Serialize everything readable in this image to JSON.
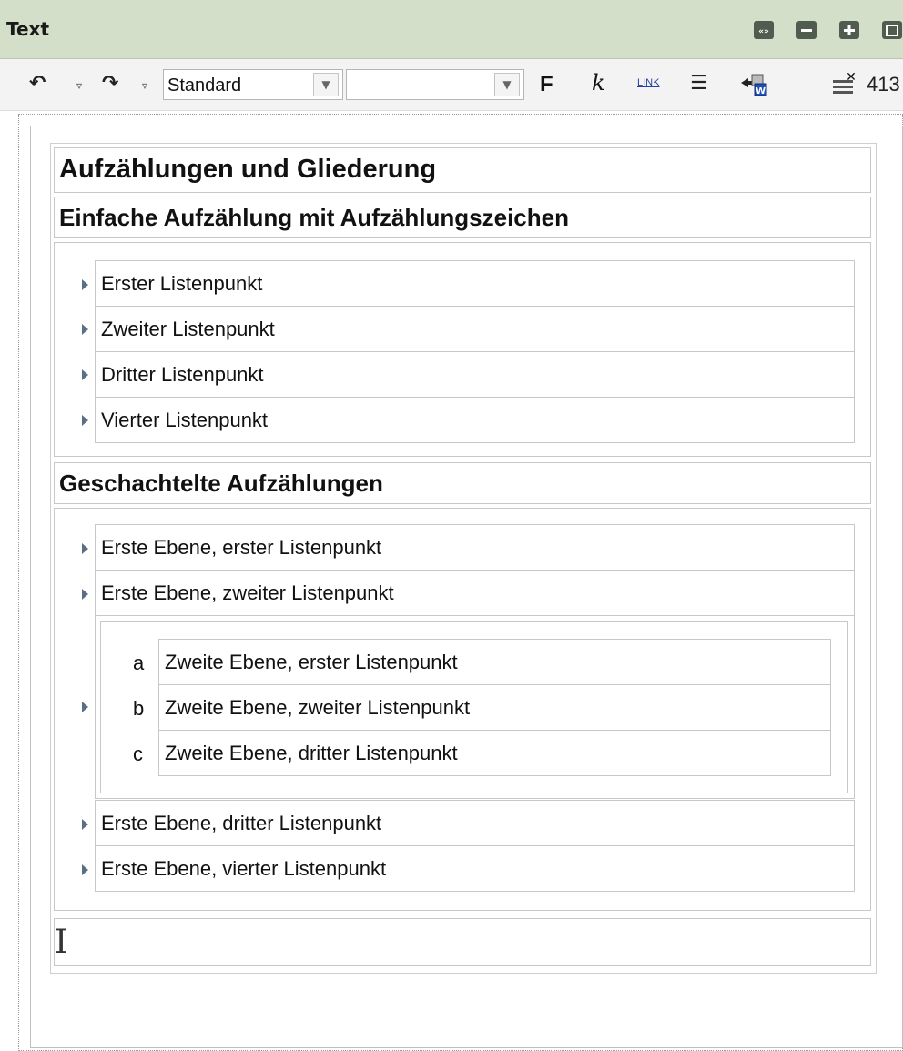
{
  "window": {
    "title": "Text",
    "buttons": [
      "expand-icon",
      "minimize-icon",
      "maximize-icon",
      "popout-icon"
    ]
  },
  "toolbar": {
    "undo_icon": "↶",
    "redo_icon": "↷",
    "dropdown_glyph": "▿",
    "style_value": "Standard",
    "font_value": "",
    "select_arrow": "▼",
    "bold_label": "F",
    "italic_label": "k",
    "link_label": "LINK",
    "list_icon": "☰",
    "word_icon": "W",
    "clear_icon": "✕",
    "count": "413"
  },
  "document": {
    "heading1": "Aufzählungen und Gliederung",
    "section1_title": "Einfache Aufzählung mit Aufzählungszeichen",
    "simple_list": [
      "Erster Listenpunkt",
      "Zweiter Listenpunkt",
      "Dritter Listenpunkt",
      "Vierter Listenpunkt"
    ],
    "section2_title": "Geschachtelte Aufzählungen",
    "nested_list": {
      "top_before": [
        "Erste Ebene, erster Listenpunkt",
        "Erste Ebene, zweiter Listenpunkt"
      ],
      "sub_items": [
        {
          "marker": "a",
          "text": "Zweite Ebene, erster Listenpunkt"
        },
        {
          "marker": "b",
          "text": "Zweite Ebene, zweiter Listenpunkt"
        },
        {
          "marker": "c",
          "text": "Zweite Ebene, dritter Listenpunkt"
        }
      ],
      "top_after": [
        "Erste Ebene, dritter Listenpunkt",
        "Erste Ebene, vierter Listenpunkt"
      ]
    },
    "caret": "I"
  }
}
